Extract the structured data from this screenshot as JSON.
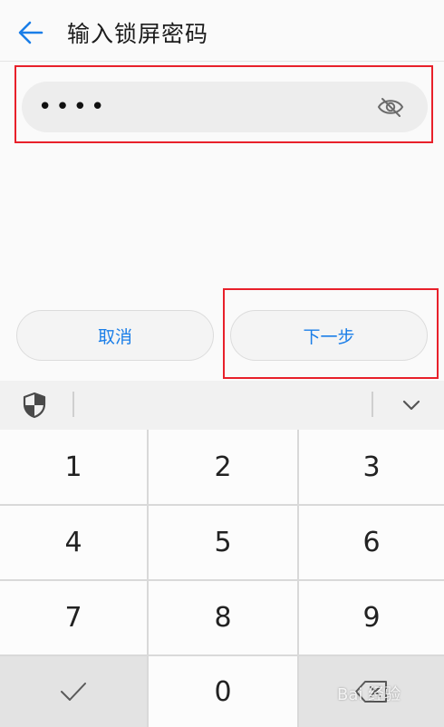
{
  "header": {
    "title": "输入锁屏密码"
  },
  "password": {
    "value": "••••"
  },
  "actions": {
    "cancel_label": "取消",
    "next_label": "下一步"
  },
  "keypad": {
    "keys": [
      "1",
      "2",
      "3",
      "4",
      "5",
      "6",
      "7",
      "8",
      "9",
      "0"
    ]
  },
  "watermark": {
    "text": "Bai 经验"
  },
  "colors": {
    "accent": "#1a7ee8",
    "highlight_box": "#e8202a"
  },
  "icons": {
    "back": "arrow-left-icon",
    "visibility": "eye-off-icon",
    "security": "shield-icon",
    "collapse": "chevron-down-icon",
    "confirm": "checkmark-icon",
    "delete": "backspace-icon"
  }
}
